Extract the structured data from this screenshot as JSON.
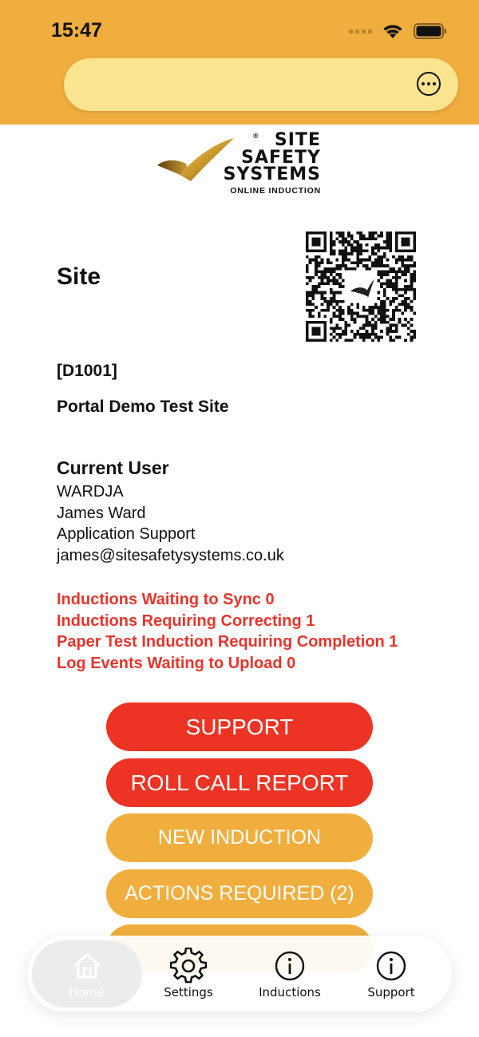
{
  "status_bar": {
    "time": "15:47"
  },
  "logo": {
    "line1": "SITE",
    "line2": "SAFETY",
    "line3": "SYSTEMS",
    "tagline": "ONLINE INDUCTION",
    "registered": "®"
  },
  "site": {
    "label": "Site",
    "code": "[D1001]",
    "name": "Portal Demo Test Site"
  },
  "current_user": {
    "heading": "Current User",
    "username": "WARDJA",
    "full_name": "James Ward",
    "role": "Application Support",
    "email": "james@sitesafetysystems.co.uk"
  },
  "status_lines": [
    "Inductions Waiting to Sync 0",
    "Inductions Requiring Correcting 1",
    "Paper Test Induction Requiring Completion 1",
    "Log Events Waiting to Upload 0"
  ],
  "buttons": {
    "support": "SUPPORT",
    "roll_call": "ROLL CALL REPORT",
    "new_induction": "NEW INDUCTION",
    "actions_required": "ACTIONS REQUIRED (2)"
  },
  "tabs": [
    {
      "label": "Home",
      "icon": "house-icon"
    },
    {
      "label": "Settings",
      "icon": "gear-icon"
    },
    {
      "label": "Inductions",
      "icon": "info-icon"
    },
    {
      "label": "Support",
      "icon": "info-icon"
    }
  ],
  "colors": {
    "header": "#f0ae3e",
    "url_bar": "#fbe48f",
    "alert_red": "#e8342b",
    "button_red": "#ec3324",
    "button_orange": "#f0ae3e"
  }
}
